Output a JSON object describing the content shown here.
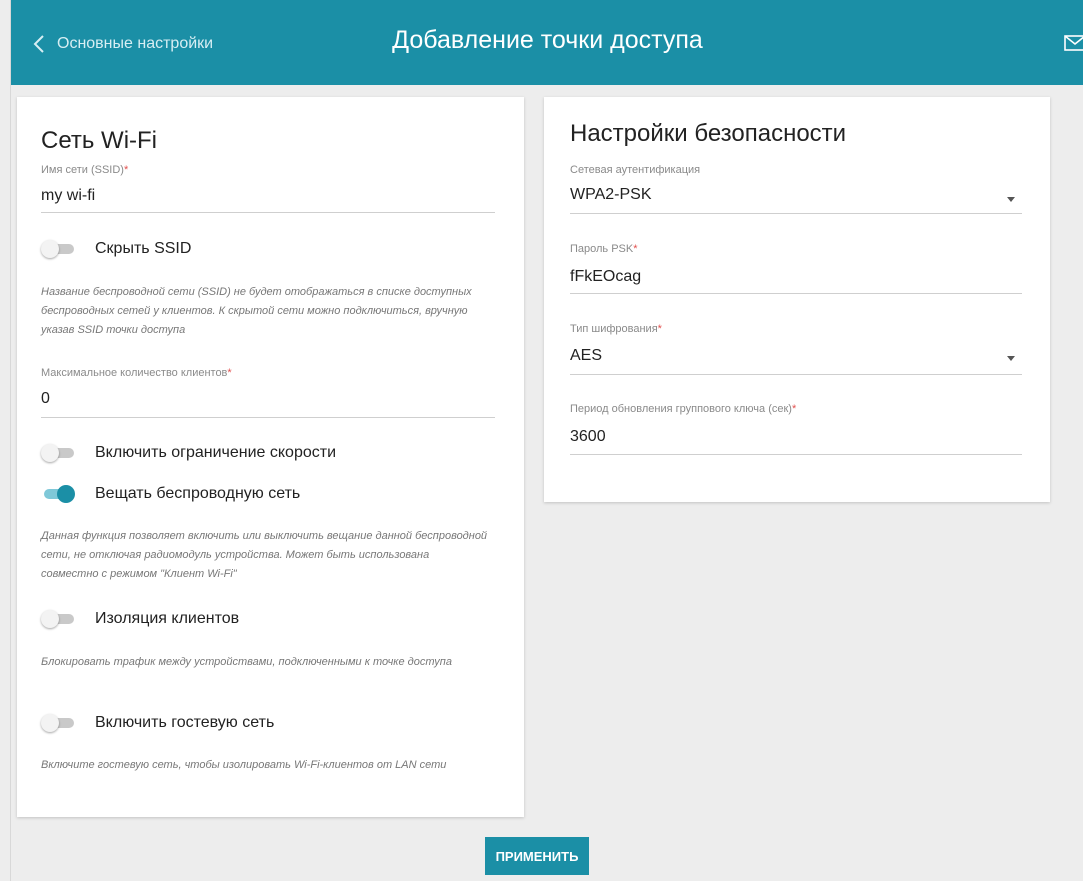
{
  "header": {
    "back_label": "Основные настройки",
    "title": "Добавление точки доступа",
    "accent_color": "#1b8fa6"
  },
  "wifi": {
    "heading": "Сеть Wi-Fi",
    "ssid_label": "Имя сети (SSID)",
    "ssid_value": "my wi-fi",
    "hide_ssid": {
      "label": "Скрыть SSID",
      "enabled": false
    },
    "hide_ssid_hint": "Название беспроводной сети (SSID) не будет отображаться в списке доступных беспроводных сетей у клиентов. К скрытой сети можно подключиться, вручную указав SSID точки доступа",
    "max_clients_label": "Максимальное количество клиентов",
    "max_clients_value": "0",
    "speed_limit": {
      "label": "Включить ограничение скорости",
      "enabled": false
    },
    "broadcast": {
      "label": "Вещать беспроводную сеть",
      "enabled": true
    },
    "broadcast_hint": "Данная функция позволяет включить или выключить вещание данной беспроводной сети, не отключая радиомодуль устройства. Может быть использована совместно с режимом \"Клиент Wi-Fi\"",
    "client_isolation": {
      "label": "Изоляция клиентов",
      "enabled": false
    },
    "client_isolation_hint": "Блокировать трафик между устройствами, подключенными к точке доступа",
    "guest_network": {
      "label": "Включить гостевую сеть",
      "enabled": false
    },
    "guest_network_hint": "Включите гостевую сеть, чтобы изолировать Wi-Fi-клиентов от LAN сети"
  },
  "security": {
    "heading": "Настройки безопасности",
    "auth_label": "Сетевая аутентификация",
    "auth_value": "WPA2-PSK",
    "psk_label": "Пароль PSK",
    "psk_value": "fFkEOcag",
    "cipher_label": "Тип шифрования",
    "cipher_value": "AES",
    "rekey_label": "Период обновления группового ключа (сек)",
    "rekey_value": "3600"
  },
  "required_mark": "*",
  "apply_label": "ПРИМЕНИТЬ"
}
